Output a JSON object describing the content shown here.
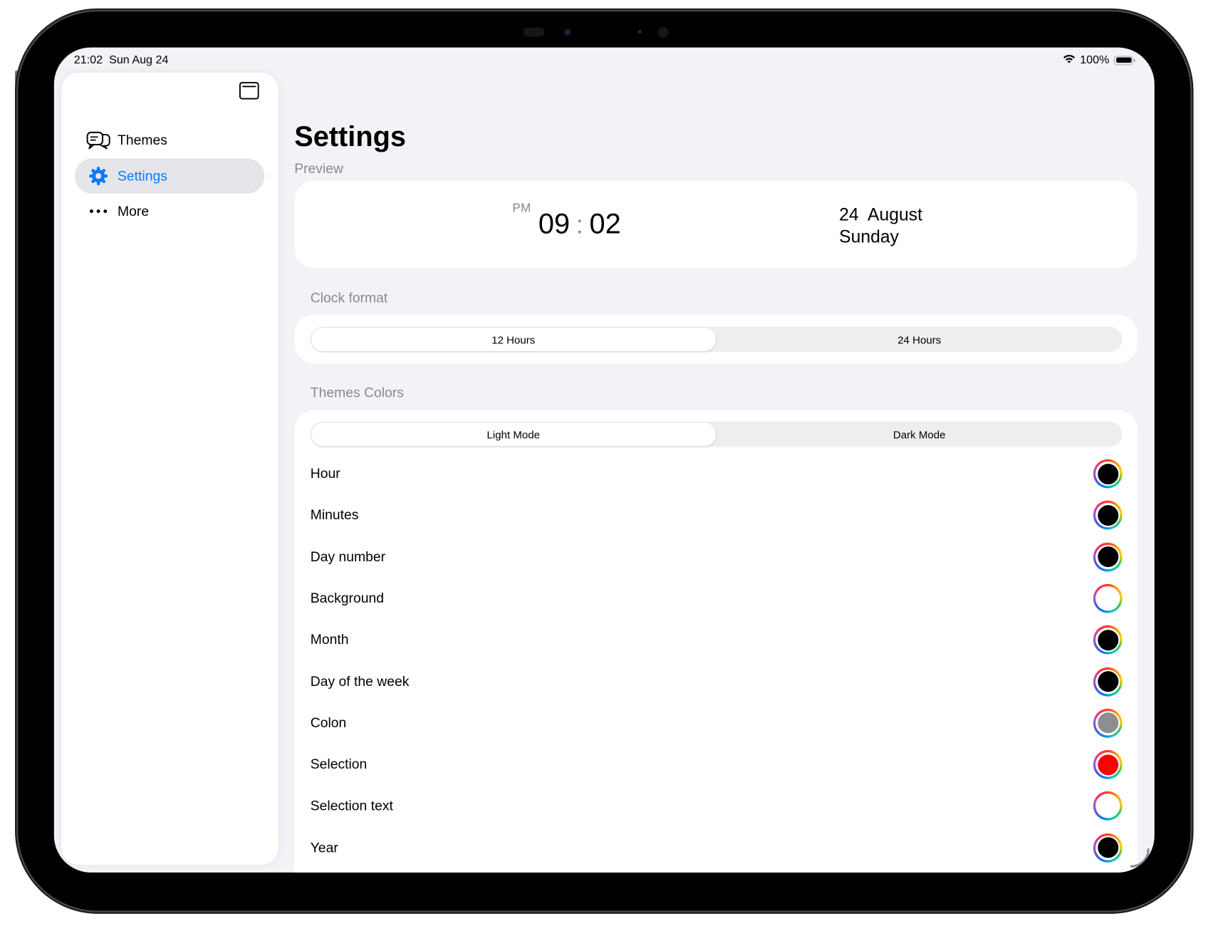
{
  "status_bar": {
    "time": "21:02",
    "date": "Sun Aug 24",
    "battery": "100%"
  },
  "sidebar": {
    "items": [
      {
        "label": "Themes",
        "icon": "themes-icon",
        "selected": false
      },
      {
        "label": "Settings",
        "icon": "gear-icon",
        "selected": true
      },
      {
        "label": "More",
        "icon": "ellipsis-icon",
        "selected": false
      }
    ]
  },
  "main": {
    "title": "Settings",
    "preview": {
      "section_label": "Preview",
      "period": "PM",
      "hour": "09",
      "colon": ":",
      "minutes": "02",
      "date_line": "24  August",
      "weekday": "Sunday"
    },
    "clock_format": {
      "section_label": "Clock format",
      "options": [
        "12 Hours",
        "24 Hours"
      ],
      "selected": "12 Hours"
    },
    "themes_colors": {
      "section_label": "Themes Colors",
      "modes": [
        "Light Mode",
        "Dark Mode"
      ],
      "selected_mode": "Light Mode",
      "rows": [
        {
          "label": "Hour",
          "color": "#000000"
        },
        {
          "label": "Minutes",
          "color": "#000000"
        },
        {
          "label": "Day number",
          "color": "#000000"
        },
        {
          "label": "Background",
          "color": "#ffffff"
        },
        {
          "label": "Month",
          "color": "#000000"
        },
        {
          "label": "Day of the week",
          "color": "#000000"
        },
        {
          "label": "Colon",
          "color": "#8e8e8e"
        },
        {
          "label": "Selection",
          "color": "#ff0000"
        },
        {
          "label": "Selection text",
          "color": "#ffffff"
        },
        {
          "label": "Year",
          "color": "#000000"
        }
      ]
    }
  },
  "colors": {
    "accent": "#0a7aff",
    "background": "#f2f2f7",
    "card": "#ffffff",
    "secondary_text": "#8a8a8e"
  }
}
